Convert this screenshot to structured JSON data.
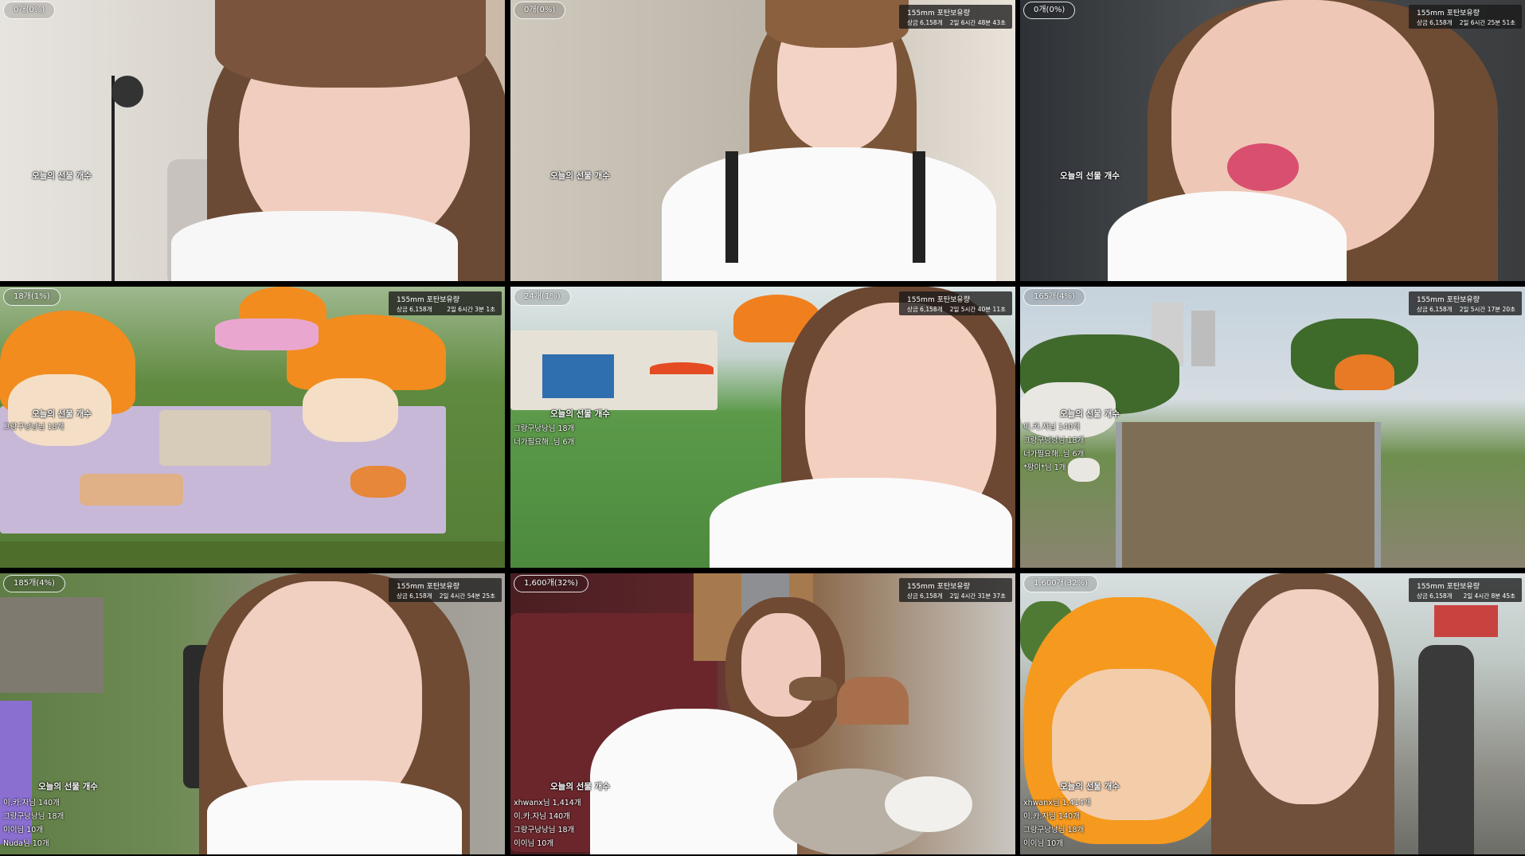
{
  "tiles": [
    {
      "gift_counter": "0개(0%)",
      "stream_info": null,
      "gift_label": "오늘의 선물 개수",
      "gift_list": []
    },
    {
      "gift_counter": "0개(0%)",
      "stream_info": {
        "title": "155mm 포탄보유량",
        "sub": "상금 6,158개",
        "time": "2일 6시간 48분 43초"
      },
      "gift_label": "오늘의 선물 개수",
      "gift_list": []
    },
    {
      "gift_counter": "0개(0%)",
      "stream_info": {
        "title": "155mm 포탄보유량",
        "sub": "상금 6,158개",
        "time": "2일 6시간 25분 51초"
      },
      "gift_label": "오늘의 선물 개수",
      "gift_list": []
    },
    {
      "gift_counter": "18개(1%)",
      "stream_info": {
        "title": "155mm 포탄보유량",
        "sub": "상금 6,158개",
        "time": "2일 6시간 3분 1초"
      },
      "gift_label": "오늘의 선물 개수",
      "gift_list": [
        "그랑구낭낭님 18개"
      ]
    },
    {
      "gift_counter": "24개(1%)",
      "stream_info": {
        "title": "155mm 포탄보유량",
        "sub": "상금 6,158개",
        "time": "2일 5시간 40분 11초"
      },
      "gift_label": "오늘의 선물 개수",
      "gift_list": [
        "그랑구낭낭님 18개",
        "너가필요해..님 6개"
      ]
    },
    {
      "gift_counter": "165개(4%)",
      "stream_info": {
        "title": "155mm 포탄보유량",
        "sub": "상금 6,158개",
        "time": "2일 5시간 17분 20초"
      },
      "gift_label": "오늘의 선물 개수",
      "gift_list": [
        "이.카.자님 140개",
        "그랑구낭낭님 18개",
        "너가필요해..님 6개",
        "*팡이*님 1개"
      ]
    },
    {
      "gift_counter": "185개(4%)",
      "stream_info": {
        "title": "155mm 포탄보유량",
        "sub": "상금 6,158개",
        "time": "2일 4시간 54분 25초"
      },
      "gift_label": "오늘의 선물 개수",
      "gift_list": [
        "이.카.자님 140개",
        "그랑구낭낭님 18개",
        "이이님 10개",
        "Nuda님 10개"
      ]
    },
    {
      "gift_counter": "1,600개(32%)",
      "stream_info": {
        "title": "155mm 포탄보유량",
        "sub": "상금 6,158개",
        "time": "2일 4시간 31분 37초"
      },
      "gift_label": "오늘의 선물 개수",
      "gift_list": [
        "xhwanx님 1,414개",
        "이.카.자님 140개",
        "그랑구낭낭님 18개",
        "이이님 10개"
      ]
    },
    {
      "gift_counter": "1,600개(32%)",
      "stream_info": {
        "title": "155mm 포탄보유량",
        "sub": "상금 6,158개",
        "time": "2일 4시간 8분 45초"
      },
      "gift_label": "오늘의 선물 개수",
      "gift_list": [
        "xhwanx님 1,414개",
        "이.카.자님 140개",
        "그랑구낭낭님 18개",
        "이이님 10개"
      ]
    }
  ]
}
